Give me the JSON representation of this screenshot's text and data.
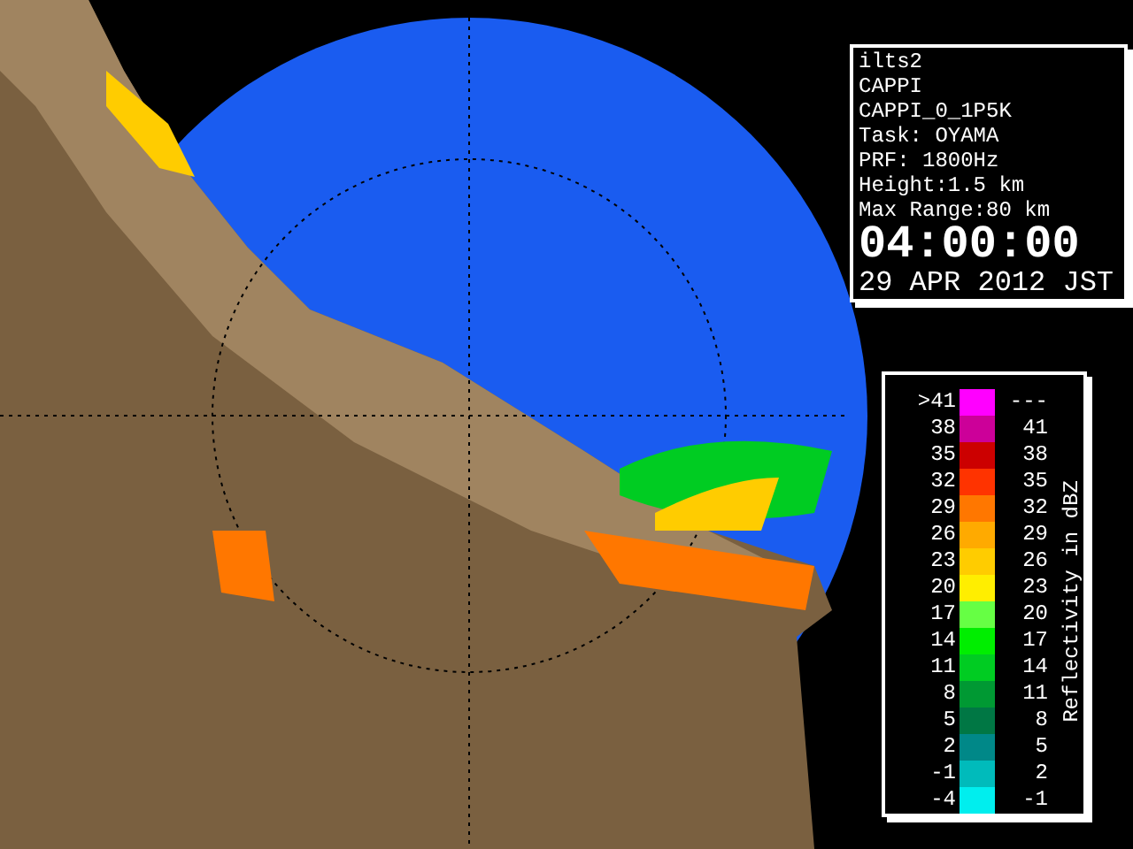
{
  "info": {
    "lines": [
      "ilts2",
      "CAPPI",
      "CAPPI_0_1P5K",
      "Task: OYAMA",
      "PRF: 1800Hz",
      "Height:1.5 km",
      "Max Range:80 km"
    ],
    "time": "04:00:00",
    "date": "29 APR 2012 JST"
  },
  "legend": {
    "title": "Reflectivity in dBZ",
    "rows": [
      {
        "low": ">41",
        "high": "---",
        "color": "#ff00ff"
      },
      {
        "low": "38",
        "high": "41",
        "color": "#cc0099"
      },
      {
        "low": "35",
        "high": "38",
        "color": "#cc0000"
      },
      {
        "low": "32",
        "high": "35",
        "color": "#ff3300"
      },
      {
        "low": "29",
        "high": "32",
        "color": "#ff7700"
      },
      {
        "low": "26",
        "high": "29",
        "color": "#ffaa00"
      },
      {
        "low": "23",
        "high": "26",
        "color": "#ffcc00"
      },
      {
        "low": "20",
        "high": "23",
        "color": "#ffee00"
      },
      {
        "low": "17",
        "high": "20",
        "color": "#66ff44"
      },
      {
        "low": "14",
        "high": "17",
        "color": "#00ee00"
      },
      {
        "low": "11",
        "high": "14",
        "color": "#00cc22"
      },
      {
        "low": "8",
        "high": "11",
        "color": "#009933"
      },
      {
        "low": "5",
        "high": "8",
        "color": "#007744"
      },
      {
        "low": "2",
        "high": "5",
        "color": "#008888"
      },
      {
        "low": "-1",
        "high": "2",
        "color": "#00bbbb"
      },
      {
        "low": "-4",
        "high": "-1",
        "color": "#00eeee"
      }
    ]
  }
}
